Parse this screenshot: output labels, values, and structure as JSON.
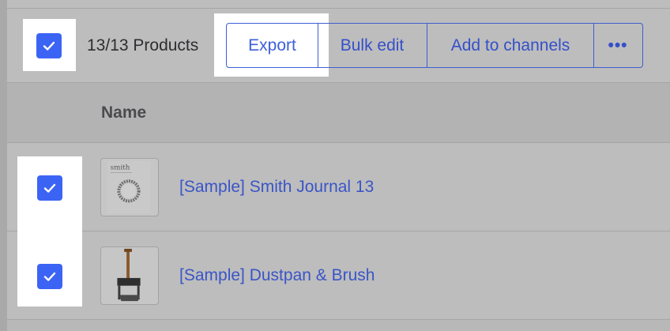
{
  "toolbar": {
    "select_all_checked": true,
    "count_label": "13/13 Products",
    "export_label": "Export",
    "bulk_edit_label": "Bulk edit",
    "add_to_channels_label": "Add to channels",
    "more_label": "•••"
  },
  "table": {
    "columns": [
      "Name"
    ],
    "rows": [
      {
        "name": "[Sample] Smith Journal 13",
        "checked": true,
        "thumbnail_icon": "journal-thumbnail-icon"
      },
      {
        "name": "[Sample] Dustpan & Brush",
        "checked": true,
        "thumbnail_icon": "dustpan-thumbnail-icon"
      }
    ]
  },
  "colors": {
    "checkbox": "#3c64f4",
    "link": "#3a55c6",
    "overlay": "#bdbdbe",
    "highlight": "#ffffff"
  }
}
